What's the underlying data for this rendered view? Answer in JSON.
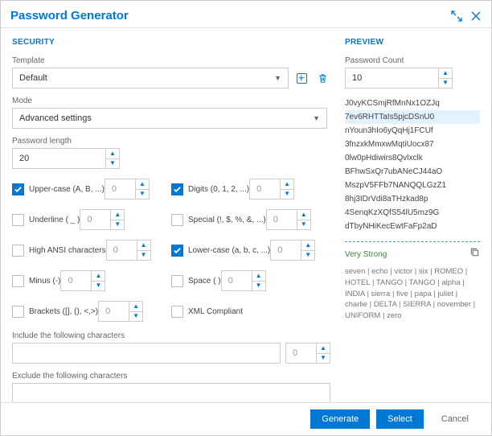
{
  "header": {
    "title": "Password Generator"
  },
  "security": {
    "heading": "SECURITY",
    "template_label": "Template",
    "template_value": "Default",
    "mode_label": "Mode",
    "mode_value": "Advanced settings",
    "length_label": "Password length",
    "length_value": "20",
    "options": {
      "uppercase": {
        "label": "Upper-case (A, B, ...)",
        "checked": true,
        "count": "0"
      },
      "digits": {
        "label": "Digits (0, 1, 2, ...)",
        "checked": true,
        "count": "0"
      },
      "underline": {
        "label": "Underline ( _ )",
        "checked": false,
        "count": "0"
      },
      "special": {
        "label": "Special (!, $, %, &, ...)",
        "checked": false,
        "count": "0"
      },
      "highansi": {
        "label": "High ANSI characters",
        "checked": false,
        "count": "0"
      },
      "lowercase": {
        "label": "Lower-case (a, b, c, ...)",
        "checked": true,
        "count": "0"
      },
      "minus": {
        "label": "Minus (-)",
        "checked": false,
        "count": "0"
      },
      "space": {
        "label": "Space ( )",
        "checked": false,
        "count": "0"
      },
      "brackets": {
        "label": "Brackets ([], (), <,>)",
        "checked": false,
        "count": "0"
      },
      "xml": {
        "label": "XML Compliant",
        "checked": false
      }
    },
    "include_label": "Include the following characters",
    "include_value": "",
    "include_count": "0",
    "exclude_label": "Exclude the following characters",
    "exclude_value": ""
  },
  "preview": {
    "heading": "PREVIEW",
    "count_label": "Password Count",
    "count_value": "10",
    "passwords": [
      "J0vyKCSmjRfMnNx1OZJq",
      "7ev6RHTTaIs5pjcDSnU0",
      "nYoun3hIo6yQqHj1FCUf",
      "3fnzxkMmxwMqtiUocx87",
      "0lw0pHdiwirs8Qvlxclk",
      "BFhwSxQr7ubANeCJ44aO",
      "MszpV5FFb7NANQQLGzZ1",
      "8hj3IDrVdi8aTHzkad8p",
      "4SenqKzXQfS54lU5mz9G",
      "dTbyNHiKecEwtFaFp2aD"
    ],
    "selected_index": 1,
    "strength": "Very Strong",
    "phonetic": "seven | echo | victor | six | ROMEO | HOTEL | TANGO | TANGO | alpha | INDIA | sierra | five | papa | juliet | charlie | DELTA | SIERRA | november | UNIFORM | zero"
  },
  "footer": {
    "generate": "Generate",
    "select": "Select",
    "cancel": "Cancel"
  }
}
